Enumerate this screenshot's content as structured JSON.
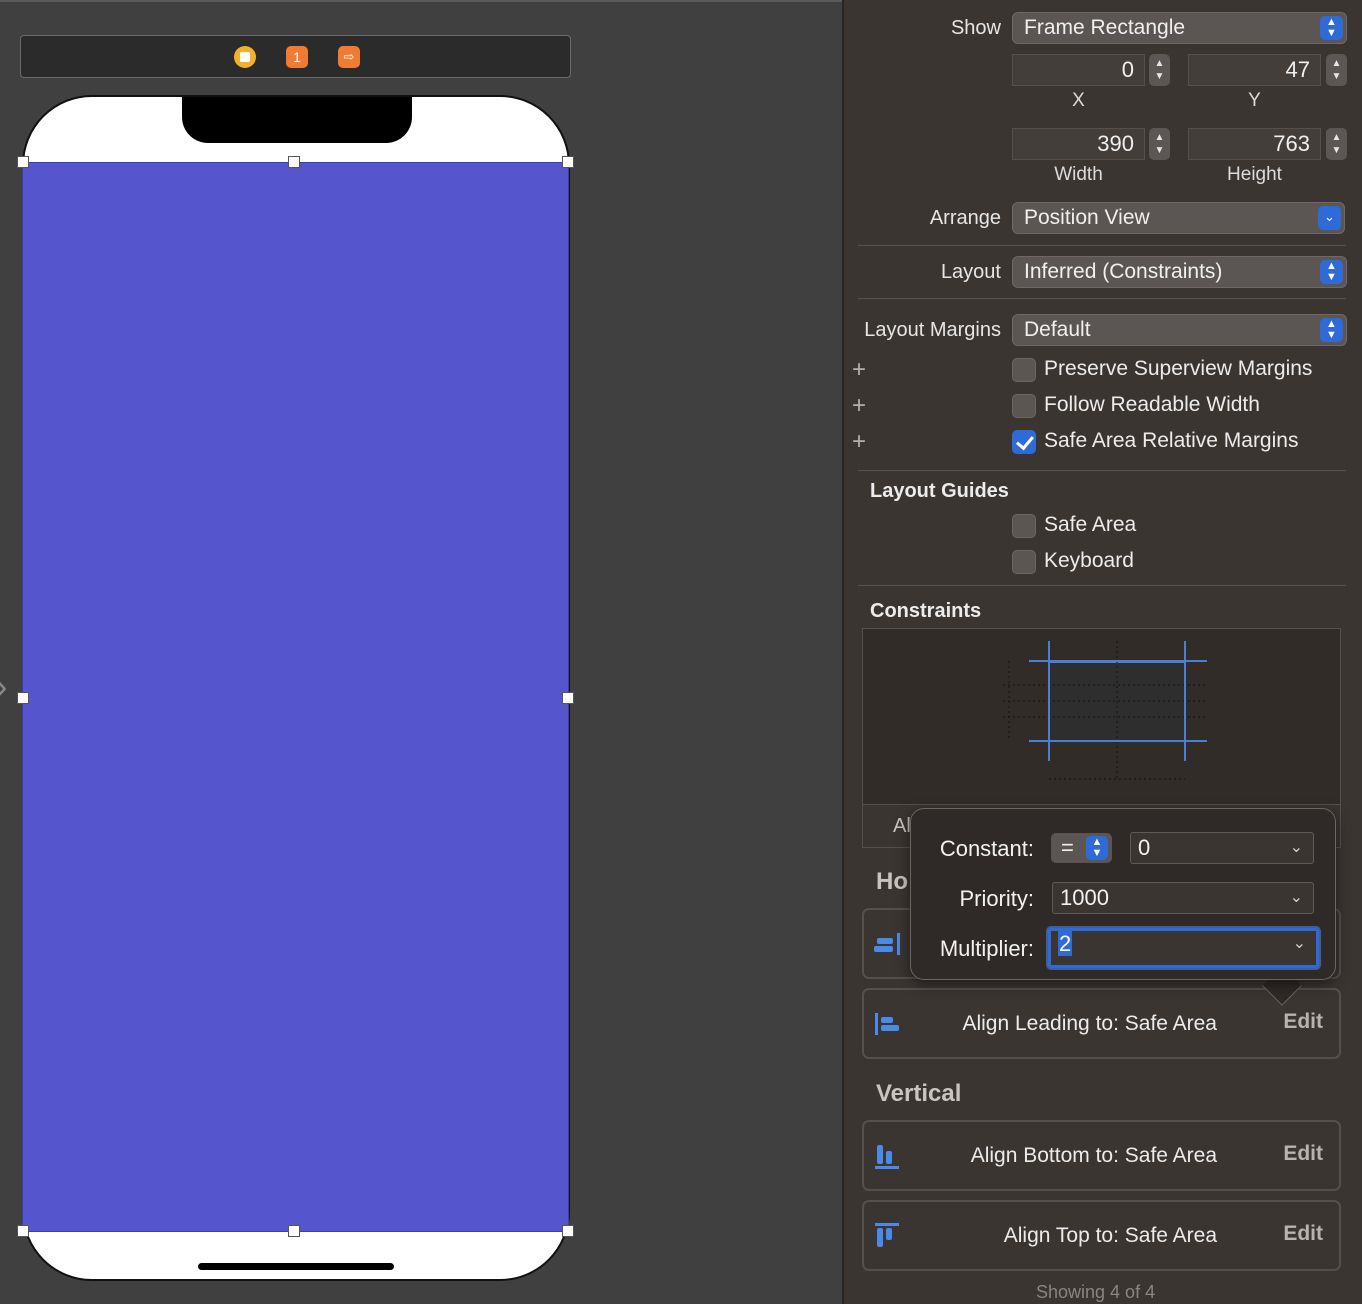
{
  "inspector": {
    "show_label": "Show",
    "show_value": "Frame Rectangle",
    "x_value": "0",
    "y_value": "47",
    "x_label": "X",
    "y_label": "Y",
    "width_value": "390",
    "height_value": "763",
    "width_label": "Width",
    "height_label": "Height",
    "arrange_label": "Arrange",
    "arrange_value": "Position View",
    "layout_label": "Layout",
    "layout_value": "Inferred (Constraints)",
    "layout_margins_label": "Layout Margins",
    "layout_margins_value": "Default",
    "checkboxes": [
      {
        "label": "Preserve Superview Margins",
        "checked": false
      },
      {
        "label": "Follow Readable Width",
        "checked": false
      },
      {
        "label": "Safe Area Relative Margins",
        "checked": true
      }
    ],
    "layout_guides_title": "Layout Guides",
    "guides": [
      {
        "label": "Safe Area",
        "checked": false
      },
      {
        "label": "Keyboard",
        "checked": false
      }
    ],
    "constraints_title": "Constraints",
    "constraints_footer": "Al",
    "horizontal_title": "Ho",
    "vertical_title": "Vertical",
    "rows": [
      {
        "text": "Align Leading to:  Safe Area",
        "edit": "Edit"
      },
      {
        "text": "Align Bottom to:  Safe Area",
        "edit": "Edit"
      },
      {
        "text": "Align Top to:  Safe Area",
        "edit": "Edit"
      }
    ],
    "showing": "Showing 4 of 4"
  },
  "popover": {
    "constant_label": "Constant:",
    "relation": "=",
    "constant_value": "0",
    "priority_label": "Priority:",
    "priority_value": "1000",
    "multiplier_label": "Multiplier:",
    "multiplier_value": "2"
  },
  "scene": {
    "first_responder_glyph": "1",
    "exit_glyph": "⇨"
  },
  "colors": {
    "view_background": "#5555cd",
    "accent": "#2f6bd6"
  }
}
